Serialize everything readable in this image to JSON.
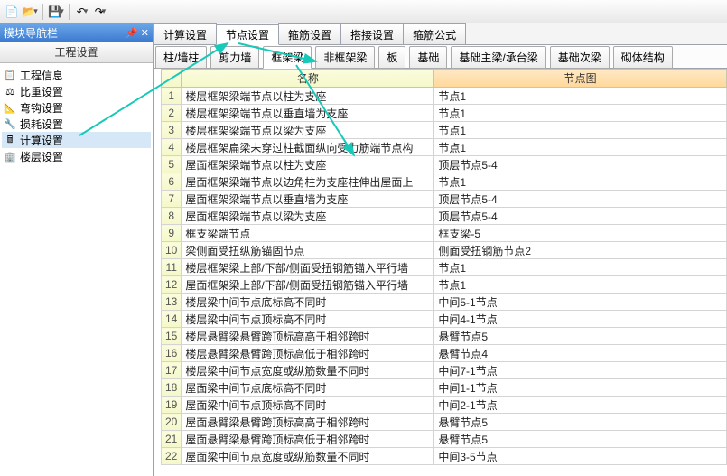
{
  "toolbar": {
    "new_icon": "📄",
    "open_icon": "📂",
    "save_icon": "💾",
    "undo_icon": "↶",
    "redo_icon": "↷"
  },
  "left_panel": {
    "title": "模块导航栏",
    "pin_icon": "📌",
    "close_icon": "✕",
    "header": "工程设置",
    "items": [
      {
        "icon": "📋",
        "label": "工程信息"
      },
      {
        "icon": "⚖",
        "label": "比重设置"
      },
      {
        "icon": "📐",
        "label": "弯钩设置"
      },
      {
        "icon": "🔧",
        "label": "损耗设置"
      },
      {
        "icon": "🖩",
        "label": "计算设置"
      },
      {
        "icon": "🏢",
        "label": "楼层设置"
      }
    ]
  },
  "tabs_top": [
    {
      "label": "计算设置"
    },
    {
      "label": "节点设置"
    },
    {
      "label": "箍筋设置"
    },
    {
      "label": "搭接设置"
    },
    {
      "label": "箍筋公式"
    }
  ],
  "tabs_sub": [
    {
      "label": "柱/墙柱"
    },
    {
      "label": "剪力墙"
    },
    {
      "label": "框架梁"
    },
    {
      "label": "非框架梁"
    },
    {
      "label": "板"
    },
    {
      "label": "基础"
    },
    {
      "label": "基础主梁/承台梁"
    },
    {
      "label": "基础次梁"
    },
    {
      "label": "砌体结构"
    }
  ],
  "grid": {
    "col_name": "名称",
    "col_node": "节点图",
    "rows": [
      {
        "n": "1",
        "name": "楼层框架梁端节点以柱为支座",
        "node": "节点1"
      },
      {
        "n": "2",
        "name": "楼层框架梁端节点以垂直墙为支座",
        "node": "节点1"
      },
      {
        "n": "3",
        "name": "楼层框架梁端节点以梁为支座",
        "node": "节点1"
      },
      {
        "n": "4",
        "name": "楼层框架扁梁未穿过柱截面纵向受力筋端节点构",
        "node": "节点1"
      },
      {
        "n": "5",
        "name": "屋面框架梁端节点以柱为支座",
        "node": "顶层节点5-4"
      },
      {
        "n": "6",
        "name": "屋面框架梁端节点以边角柱为支座柱伸出屋面上",
        "node": "节点1"
      },
      {
        "n": "7",
        "name": "屋面框架梁端节点以垂直墙为支座",
        "node": "顶层节点5-4"
      },
      {
        "n": "8",
        "name": "屋面框架梁端节点以梁为支座",
        "node": "顶层节点5-4"
      },
      {
        "n": "9",
        "name": "框支梁端节点",
        "node": "框支梁-5"
      },
      {
        "n": "10",
        "name": "梁侧面受扭纵筋锚固节点",
        "node": "侧面受扭钢筋节点2"
      },
      {
        "n": "11",
        "name": "楼层框架梁上部/下部/侧面受扭钢筋锚入平行墙",
        "node": "节点1"
      },
      {
        "n": "12",
        "name": "屋面框架梁上部/下部/侧面受扭钢筋锚入平行墙",
        "node": "节点1"
      },
      {
        "n": "13",
        "name": "楼层梁中间节点底标高不同时",
        "node": "中间5-1节点"
      },
      {
        "n": "14",
        "name": "楼层梁中间节点顶标高不同时",
        "node": "中间4-1节点"
      },
      {
        "n": "15",
        "name": "楼层悬臂梁悬臂跨顶标高高于相邻跨时",
        "node": "悬臂节点5"
      },
      {
        "n": "16",
        "name": "楼层悬臂梁悬臂跨顶标高低于相邻跨时",
        "node": "悬臂节点4"
      },
      {
        "n": "17",
        "name": "楼层梁中间节点宽度或纵筋数量不同时",
        "node": "中间7-1节点"
      },
      {
        "n": "18",
        "name": "屋面梁中间节点底标高不同时",
        "node": "中间1-1节点"
      },
      {
        "n": "19",
        "name": "屋面梁中间节点顶标高不同时",
        "node": "中间2-1节点"
      },
      {
        "n": "20",
        "name": "屋面悬臂梁悬臂跨顶标高高于相邻跨时",
        "node": "悬臂节点5"
      },
      {
        "n": "21",
        "name": "屋面悬臂梁悬臂跨顶标高低于相邻跨时",
        "node": "悬臂节点5"
      },
      {
        "n": "22",
        "name": "屋面梁中间节点宽度或纵筋数量不同时",
        "node": "中间3-5节点"
      }
    ]
  }
}
